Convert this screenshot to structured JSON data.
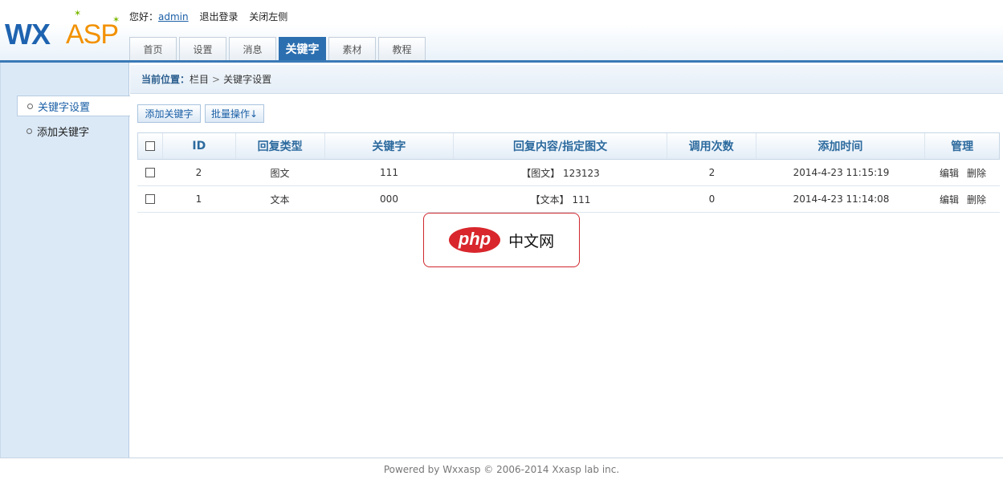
{
  "logo": {
    "part1": "WX",
    "part2": "ASP"
  },
  "userbar": {
    "greeting": "您好：",
    "username": "admin",
    "logout": "退出登录",
    "close_left": "关闭左侧"
  },
  "tabs": [
    {
      "label": "首页"
    },
    {
      "label": "设置"
    },
    {
      "label": "消息"
    },
    {
      "label": "关键字"
    },
    {
      "label": "素材"
    },
    {
      "label": "教程"
    }
  ],
  "sidebar": {
    "items": [
      {
        "label": "关键字设置"
      },
      {
        "label": "添加关键字"
      }
    ]
  },
  "breadcrumb": {
    "label": "当前位置：",
    "root": "栏目",
    "sep": ">",
    "current": "关键字设置"
  },
  "toolbar": {
    "add": "添加关键字",
    "batch": "批量操作↓"
  },
  "table": {
    "headers": [
      "ID",
      "回复类型",
      "关键字",
      "回复内容/指定图文",
      "调用次数",
      "添加时间",
      "管理"
    ],
    "rows": [
      {
        "id": "2",
        "type": "图文",
        "keyword": "111",
        "content": "【图文】 123123",
        "calls": "2",
        "time": "2014-4-23 11:15:19",
        "edit": "编辑",
        "delete": "删除"
      },
      {
        "id": "1",
        "type": "文本",
        "keyword": "000",
        "content": "【文本】 111",
        "calls": "0",
        "time": "2014-4-23 11:14:08",
        "edit": "编辑",
        "delete": "删除"
      }
    ]
  },
  "watermark": {
    "brand": "php",
    "text": "中文网"
  },
  "footer": {
    "text": "Powered by Wxxasp © 2006-2014 Xxasp lab inc."
  },
  "colors": {
    "accent": "#2c6fb0",
    "sidebar_bg": "#dbe9f7",
    "watermark_red": "#d8262c"
  }
}
